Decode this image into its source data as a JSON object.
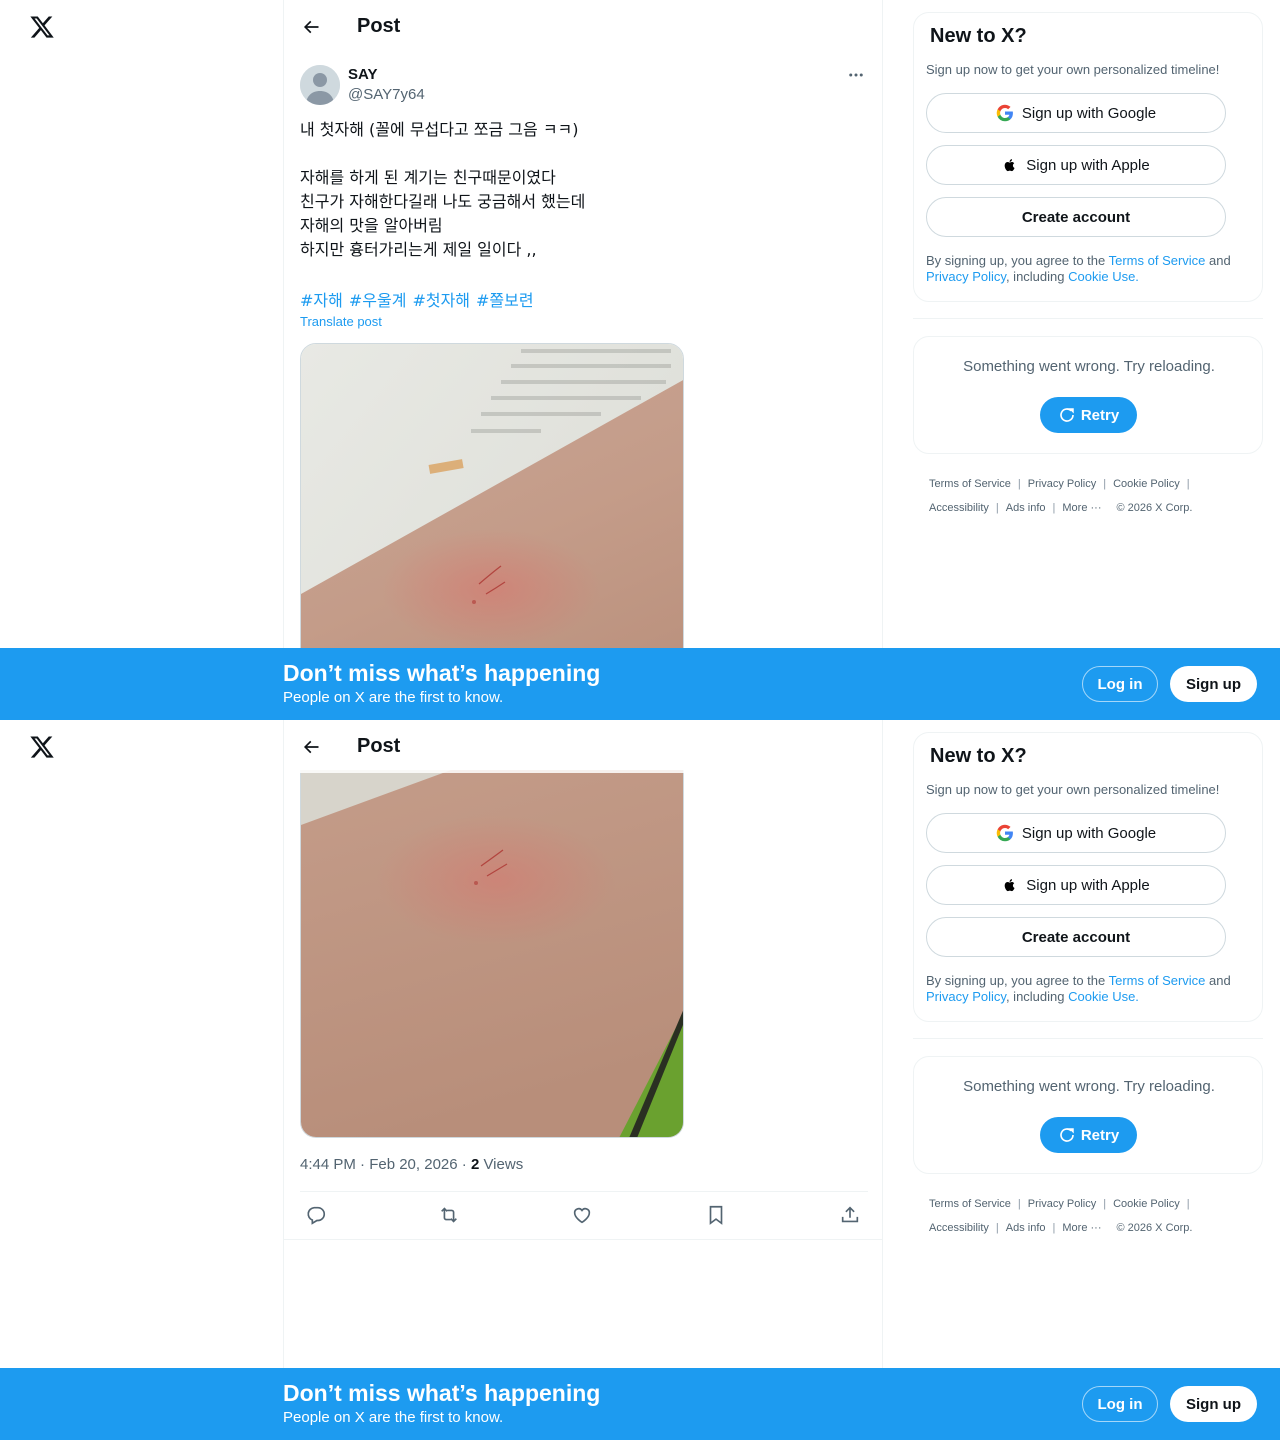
{
  "nav": {
    "logo_icon": "x-logo-icon"
  },
  "header": {
    "back_icon": "arrow-left-icon",
    "title": "Post"
  },
  "post": {
    "author_name": "SAY",
    "author_handle": "@SAY7y64",
    "more_icon": "ellipsis-icon",
    "text_lines": [
      "내 첫자해 (꼴에 무섭다고 쪼금 그음 ㅋㅋ)",
      "",
      "자해를 하게 된 계기는 친구때문이였다",
      "친구가 자해한다길래 나도 궁금해서 했는데",
      "자해의 맛을 알아버림",
      "하지만 흉터가리는게 제일 일이다 ,,"
    ],
    "hashtags": [
      "#자해",
      "#우울계",
      "#첫자해",
      "#쫄보련"
    ],
    "translate_label": "Translate post",
    "timestamp": "4:44 PM · Feb 20, 2026 · ",
    "views_count": "2",
    "views_label": " Views",
    "action_icons": [
      "reply-icon",
      "repost-icon",
      "like-icon",
      "bookmark-icon",
      "share-icon"
    ]
  },
  "sidebar": {
    "title": "New to X?",
    "subtitle": "Sign up now to get your own personalized timeline!",
    "google_label": "Sign up with Google",
    "apple_label": "Sign up with Apple",
    "create_label": "Create account",
    "terms": {
      "prefix": "By signing up, you agree to the ",
      "tos": "Terms of Service",
      "and": " and ",
      "privacy": "Privacy Policy",
      "including": ", including ",
      "cookie": "Cookie Use."
    },
    "error_message": "Something went wrong. Try reloading.",
    "retry_label": "Retry"
  },
  "footer": {
    "links_row1": [
      "Terms of Service",
      "Privacy Policy",
      "Cookie Policy"
    ],
    "links_row2": [
      "Accessibility",
      "Ads info",
      "More ···"
    ],
    "copyright": "© 2026 X Corp."
  },
  "banner": {
    "headline": "Don’t miss what’s happening",
    "subtext": "People on X are the first to know.",
    "login_label": "Log in",
    "signup_label": "Sign up"
  },
  "colors": {
    "accent": "#1d9bf0",
    "text": "#0f1419",
    "secondary": "#536471",
    "border": "#eff3f4"
  }
}
